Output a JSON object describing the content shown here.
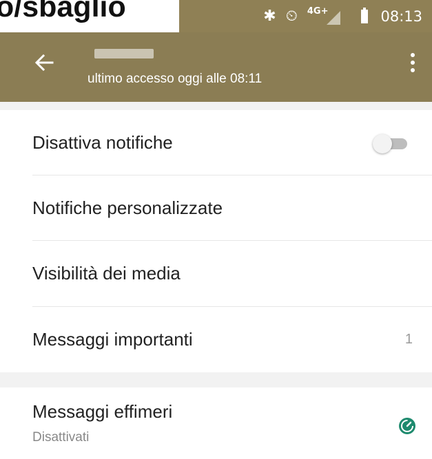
{
  "caption": {
    "text": "o/sbaglio"
  },
  "statusbar": {
    "network_label": "4G+",
    "time": "08:13",
    "icons": [
      "bluetooth-icon",
      "alarm-icon",
      "signal-icon",
      "battery-icon"
    ]
  },
  "toolbar": {
    "last_seen": "ultimo accesso oggi alle 08:11",
    "background": "#8b7d54"
  },
  "settings": {
    "items": [
      {
        "label": "Disattiva notifiche",
        "control": "toggle",
        "toggle_on": false
      },
      {
        "label": "Notifiche personalizzate"
      },
      {
        "label": "Visibilità dei media"
      },
      {
        "label": "Messaggi importanti",
        "count": "1"
      }
    ],
    "ephemeral": {
      "title": "Messaggi effimeri",
      "subtitle": "Disattivati",
      "icon": "timer-icon",
      "icon_color": "#1e8a6e"
    }
  }
}
